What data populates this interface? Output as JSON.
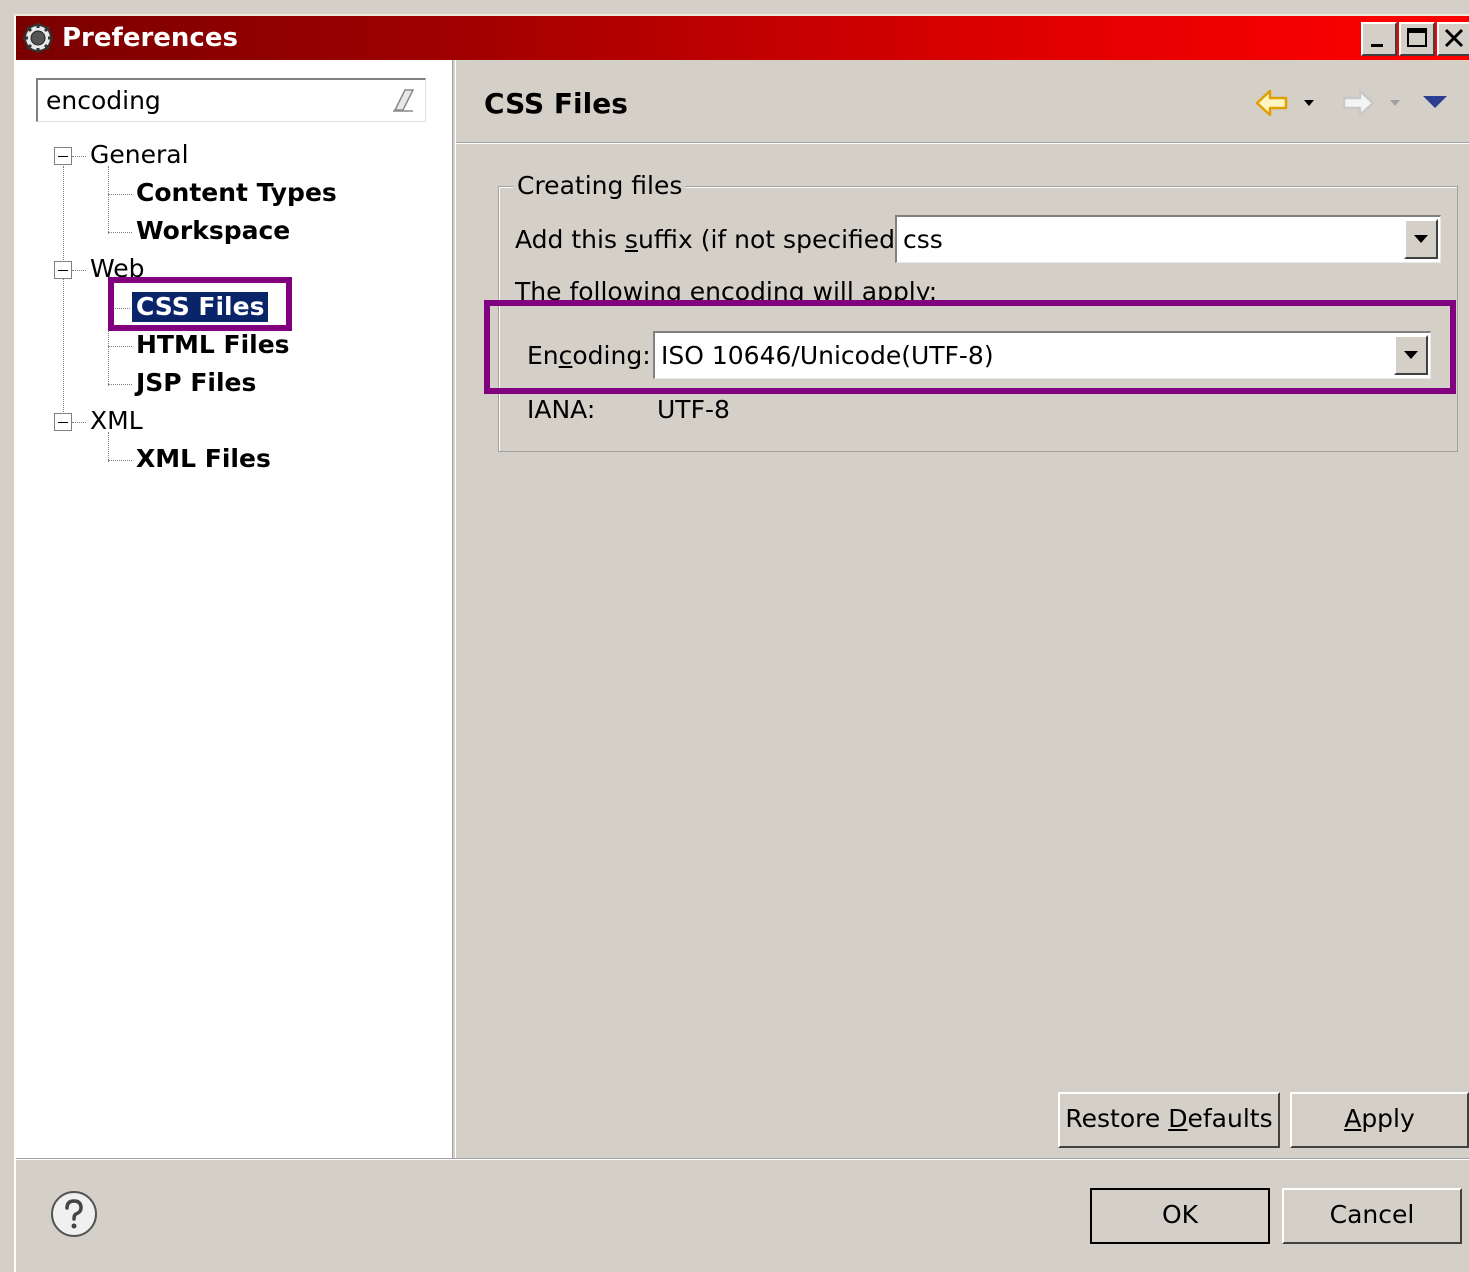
{
  "window": {
    "title": "Preferences",
    "title_bar_colors": [
      "#7a0000",
      "#ff0000"
    ],
    "caption_buttons": [
      "minimize-icon",
      "maximize-icon",
      "close-icon"
    ]
  },
  "sidebar": {
    "filter_value": "encoding",
    "tree": [
      {
        "label": "General",
        "expanded": true,
        "children": [
          "Content Types",
          "Workspace"
        ]
      },
      {
        "label": "Web",
        "expanded": true,
        "children": [
          "CSS Files",
          "HTML Files",
          "JSP Files"
        ]
      },
      {
        "label": "XML",
        "expanded": true,
        "children": [
          "XML Files"
        ]
      }
    ],
    "selected": "CSS Files"
  },
  "page": {
    "title": "CSS Files",
    "nav_icons": [
      "back-arrow-icon",
      "forward-arrow-icon",
      "view-menu-icon"
    ],
    "group": {
      "legend": "Creating files",
      "suffix_label_pre": "Add this ",
      "suffix_label_mnemonic": "s",
      "suffix_label_post": "uffix (if not specified):",
      "suffix_value": "css",
      "info_text": "The following encoding will apply:",
      "encoding_label_pre": "En",
      "encoding_label_mnemonic": "c",
      "encoding_label_post": "oding:",
      "encoding_value": "ISO 10646/Unicode(UTF-8)",
      "iana_label": "IANA:",
      "iana_value": "UTF-8"
    },
    "restore_pre": "Restore ",
    "restore_mnemonic": "D",
    "restore_post": "efaults",
    "apply_mnemonic": "A",
    "apply_post": "pply"
  },
  "footer": {
    "help_icon": "help-icon",
    "ok_label": "OK",
    "cancel_label": "Cancel"
  },
  "colors": {
    "dialog_bg": "#d4d0c8",
    "selection_bg": "#0a246a",
    "annotation_box": "#800080"
  }
}
